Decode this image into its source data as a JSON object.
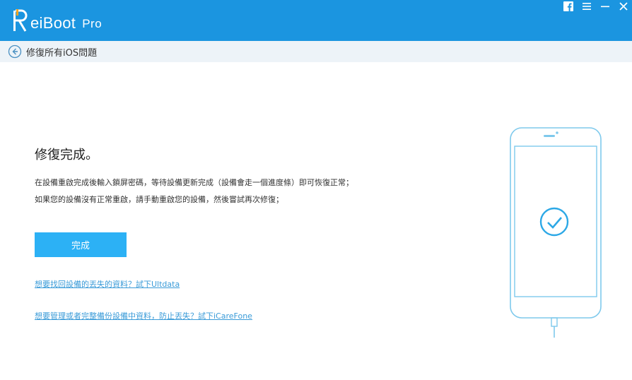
{
  "app": {
    "logo_text": "eiBoot",
    "logo_edition": "Pro",
    "colors": {
      "titlebar": "#1b95e0",
      "subbar": "#edf3f8",
      "accent_button": "#2cb1f5",
      "link": "#3a9bd8",
      "phone_outline": "#7ec9ec"
    }
  },
  "window_controls": {
    "icons": [
      "facebook-icon",
      "menu-icon",
      "minimize-icon",
      "close-icon"
    ]
  },
  "subbar": {
    "title": "修復所有iOS問題",
    "back_icon": "back-arrow-icon"
  },
  "main": {
    "title": "修復完成。",
    "description_line1": "在設備重啟完成後輸入鎖屏密碼，等待設備更新完成（設備會走一個進度條）即可恢復正常；",
    "description_line2": "如果您的設備沒有正常重啟，請手動重啟您的設備，然後嘗試再次修復；",
    "done_button": "完成",
    "link_ultdata": "想要找回設備的丟失的資料？試下Ultdata",
    "link_icarefone": "想要管理或者完整備份設備中資料，防止丟失？試下iCareFone"
  },
  "illustration": {
    "icon": "phone-check-icon"
  }
}
